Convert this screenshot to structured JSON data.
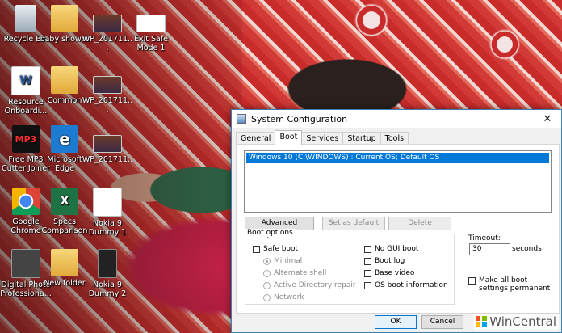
{
  "desktop": {
    "icons": [
      {
        "label": "Recycle Bin"
      },
      {
        "label": "baby shower"
      },
      {
        "label": "WP_201711..."
      },
      {
        "label": "Exit Safe Mode 1"
      },
      {
        "label": "Resource Onboardi..."
      },
      {
        "label": "Common"
      },
      {
        "label": "WP_201711..."
      },
      {
        "label": "Free MP3 Cutter Joiner"
      },
      {
        "label": "Microsoft Edge"
      },
      {
        "label": "WP_201711..."
      },
      {
        "label": "Google Chrome"
      },
      {
        "label": "Specs Comparison"
      },
      {
        "label": "Nokia 9 Dummy 1"
      },
      {
        "label": "Digital Photo Professiona..."
      },
      {
        "label": "New folder"
      },
      {
        "label": "Nokia 9 Dummy 2"
      }
    ],
    "glyphs": {
      "mp3": "MP3",
      "edge": "e",
      "word": "W",
      "excel": "X"
    }
  },
  "window": {
    "title": "System Configuration",
    "close_glyph": "✕",
    "tabs": [
      "General",
      "Boot",
      "Services",
      "Startup",
      "Tools"
    ],
    "active_tab": "Boot",
    "os_entries": [
      "Windows 10 (C:\\WINDOWS) : Current OS; Default OS"
    ],
    "buttons": {
      "advanced": "Advanced options...",
      "set_default": "Set as default",
      "delete": "Delete",
      "ok": "OK",
      "cancel": "Cancel"
    },
    "boot_options": {
      "title": "Boot options",
      "safe_boot": "Safe boot",
      "minimal": "Minimal",
      "alternate_shell": "Alternate shell",
      "active_directory_repair": "Active Directory repair",
      "network": "Network",
      "no_gui_boot": "No GUI boot",
      "boot_log": "Boot log",
      "base_video": "Base video",
      "os_boot_information": "OS boot information"
    },
    "timeout": {
      "label": "Timeout:",
      "value": "30",
      "unit": "seconds"
    },
    "make_permanent": "Make all boot settings permanent"
  },
  "watermark": {
    "text": "WinCentral"
  }
}
